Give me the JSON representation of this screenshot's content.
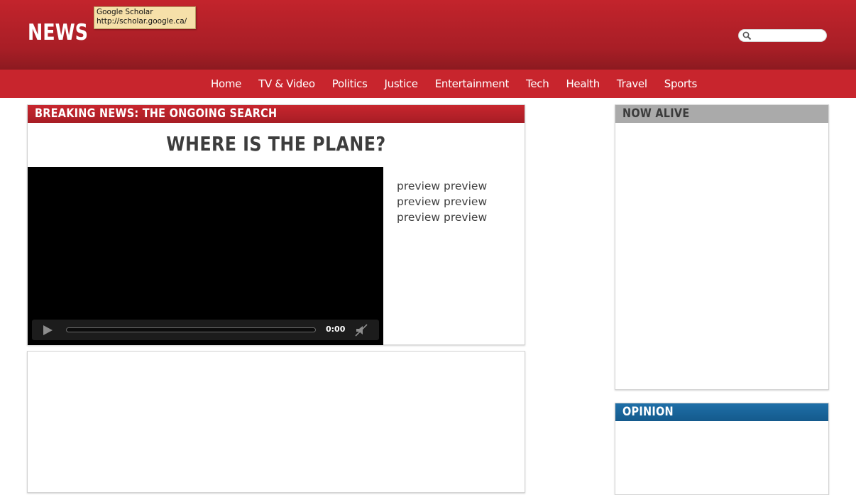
{
  "header": {
    "logo": "NEWS",
    "search": {
      "placeholder": "",
      "value": ""
    }
  },
  "tooltip": {
    "title": "Google Scholar",
    "url": "http://scholar.google.ca/"
  },
  "nav": {
    "items": [
      {
        "label": "Home"
      },
      {
        "label": "TV & Video"
      },
      {
        "label": "Politics"
      },
      {
        "label": "Justice"
      },
      {
        "label": "Entertainment"
      },
      {
        "label": "Tech"
      },
      {
        "label": "Health"
      },
      {
        "label": "Travel"
      },
      {
        "label": "Sports"
      }
    ]
  },
  "breaking": {
    "heading": "Breaking News: The Ongoing Search",
    "headline": "WHERE IS THE PLANE?",
    "video": {
      "time": "0:00"
    },
    "preview_lines": [
      "preview preview",
      "preview preview",
      "preview preview"
    ]
  },
  "sidebar": {
    "alive_heading": "Now Alive",
    "opinion_heading": "Opinion"
  },
  "colors": {
    "brand_red": "#c8252d",
    "header_dark_red": "#8c1a20",
    "opinion_blue": "#1f6fa8",
    "alive_gray": "#aaaaaa"
  },
  "icons": [
    "search-icon",
    "play-icon",
    "mute-icon"
  ]
}
